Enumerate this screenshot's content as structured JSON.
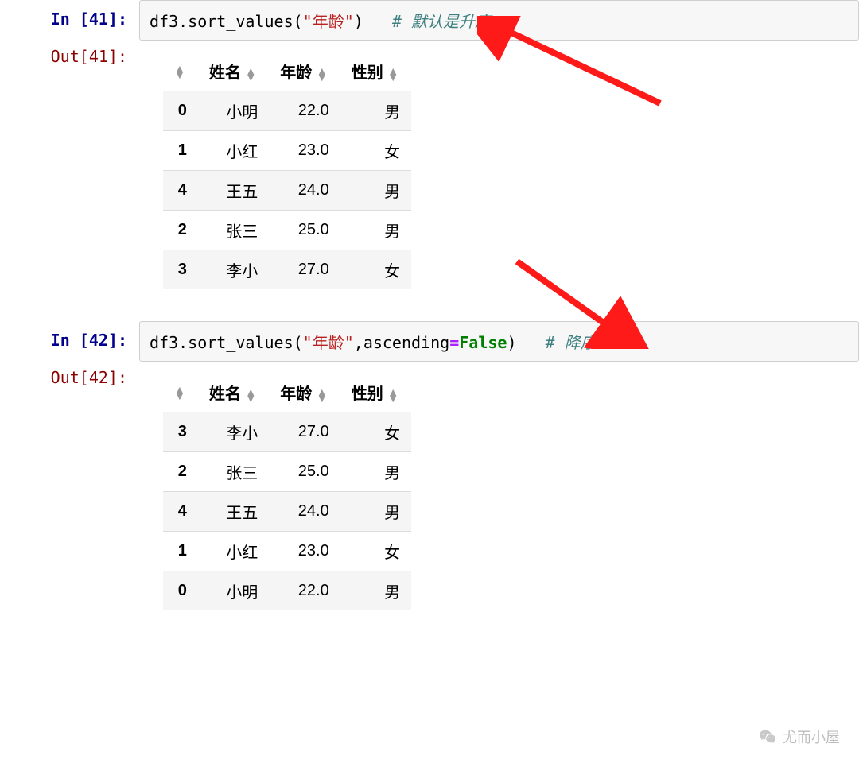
{
  "cell1": {
    "in_prompt": "In [41]:",
    "out_prompt": "Out[41]:",
    "code": {
      "obj": "df3",
      "method": "sort_values",
      "arg_str": "\"年龄\"",
      "comment": "# 默认是升序"
    },
    "table": {
      "columns": [
        "姓名",
        "年龄",
        "性别"
      ],
      "rows": [
        {
          "idx": "0",
          "姓名": "小明",
          "年龄": "22.0",
          "性别": "男"
        },
        {
          "idx": "1",
          "姓名": "小红",
          "年龄": "23.0",
          "性别": "女"
        },
        {
          "idx": "4",
          "姓名": "王五",
          "年龄": "24.0",
          "性别": "男"
        },
        {
          "idx": "2",
          "姓名": "张三",
          "年龄": "25.0",
          "性别": "男"
        },
        {
          "idx": "3",
          "姓名": "李小",
          "年龄": "27.0",
          "性别": "女"
        }
      ]
    }
  },
  "cell2": {
    "in_prompt": "In [42]:",
    "out_prompt": "Out[42]:",
    "code": {
      "obj": "df3",
      "method": "sort_values",
      "arg_str": "\"年龄\"",
      "kw_name": "ascending",
      "kw_val": "False",
      "comment": "# 降序"
    },
    "table": {
      "columns": [
        "姓名",
        "年龄",
        "性别"
      ],
      "rows": [
        {
          "idx": "3",
          "姓名": "李小",
          "年龄": "27.0",
          "性别": "女"
        },
        {
          "idx": "2",
          "姓名": "张三",
          "年龄": "25.0",
          "性别": "男"
        },
        {
          "idx": "4",
          "姓名": "王五",
          "年龄": "24.0",
          "性别": "男"
        },
        {
          "idx": "1",
          "姓名": "小红",
          "年龄": "23.0",
          "性别": "女"
        },
        {
          "idx": "0",
          "姓名": "小明",
          "年龄": "22.0",
          "性别": "男"
        }
      ]
    }
  },
  "watermark": "尤而小屋"
}
